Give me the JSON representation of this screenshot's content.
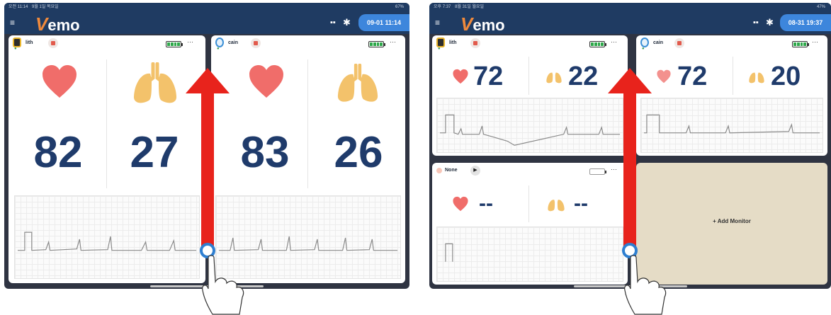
{
  "colors": {
    "appbar": "#1f3b62",
    "accent": "#3d86dc",
    "vital_text": "#1f3b6b",
    "heart": "#f06d6a",
    "lung": "#f3c26b",
    "arrow": "#e8231c",
    "add_bg": "#e5dcc6"
  },
  "left": {
    "status_time": "오전 11:14",
    "status_date": "9월 1일 목요일",
    "status_sys": "67%",
    "logo": {
      "first": "V",
      "rest": "emo"
    },
    "datetime": "09-01 11:14",
    "monitors": [
      {
        "name": "lith",
        "heart_rate": "82",
        "resp_rate": "27"
      },
      {
        "name": "cain",
        "heart_rate": "83",
        "resp_rate": "26"
      }
    ]
  },
  "right": {
    "status_time": "오후 7:37",
    "status_date": "8월 31일 월요일",
    "status_sys": "47%",
    "logo": {
      "first": "V",
      "rest": "emo"
    },
    "datetime": "08-31 19:37",
    "monitors": [
      {
        "name": "lith",
        "heart_rate": "72",
        "resp_rate": "22"
      },
      {
        "name": "cain",
        "heart_rate": "72",
        "resp_rate": "20"
      },
      {
        "name": "None",
        "heart_rate": "--",
        "resp_rate": "--"
      }
    ],
    "add_monitor": "+ Add Monitor"
  },
  "icons": {
    "menu": "hamburger-menu-icon",
    "grid": "grid-icon",
    "settings": "gear-icon",
    "heart": "heart-icon",
    "lungs": "lungs-icon",
    "record": "record-stop-icon",
    "play": "play-icon",
    "battery": "battery-icon",
    "more": "more-options-icon",
    "gesture": "swipe-up-arrow-icon",
    "hand": "hand-pointer-icon"
  },
  "gesture": {
    "more_glyph": "···",
    "grid_glyph": "▪▪",
    "gear_glyph": "✱",
    "menu_glyph": "≡"
  }
}
